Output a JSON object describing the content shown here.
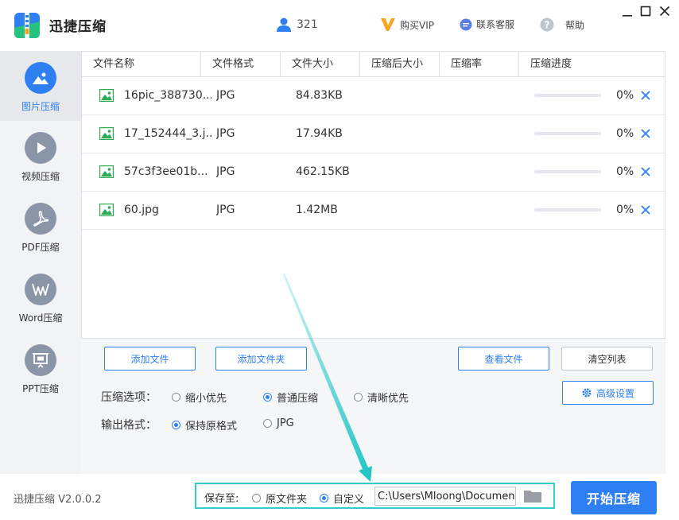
{
  "app": {
    "title": "迅捷压缩",
    "version": "迅捷压缩 V2.0.0.2"
  },
  "header": {
    "user_count": "321",
    "vip_label": "购买VIP",
    "service_label": "联系客服",
    "help_label": "帮助"
  },
  "sidebar": {
    "items": [
      {
        "label": "图片压缩",
        "icon": "image-icon",
        "active": true
      },
      {
        "label": "视频压缩",
        "icon": "play-icon",
        "active": false
      },
      {
        "label": "PDF压缩",
        "icon": "pdf-icon",
        "active": false
      },
      {
        "label": "Word压缩",
        "icon": "word-icon",
        "active": false
      },
      {
        "label": "PPT压缩",
        "icon": "ppt-icon",
        "active": false
      }
    ]
  },
  "table": {
    "columns": [
      "文件名称",
      "文件格式",
      "文件大小",
      "压缩后大小",
      "压缩率",
      "压缩进度"
    ],
    "rows": [
      {
        "name": "16pic_388730...",
        "format": "JPG",
        "size": "84.83KB",
        "compressed": "",
        "ratio": "",
        "progress": 0,
        "progress_text": "0%"
      },
      {
        "name": "17_152444_3.j...",
        "format": "JPG",
        "size": "17.94KB",
        "compressed": "",
        "ratio": "",
        "progress": 0,
        "progress_text": "0%"
      },
      {
        "name": "57c3f3ee01b...",
        "format": "JPG",
        "size": "462.15KB",
        "compressed": "",
        "ratio": "",
        "progress": 0,
        "progress_text": "0%"
      },
      {
        "name": "60.jpg",
        "format": "JPG",
        "size": "1.42MB",
        "compressed": "",
        "ratio": "",
        "progress": 0,
        "progress_text": "0%"
      }
    ]
  },
  "actions": {
    "add_file": "添加文件",
    "add_folder": "添加文件夹",
    "view_files": "查看文件",
    "clear_list": "清空列表",
    "advanced": "高级设置"
  },
  "compress_options": {
    "label": "压缩选项：",
    "options": [
      "缩小优先",
      "普通压缩",
      "清晰优先"
    ],
    "selected": "普通压缩"
  },
  "output_format": {
    "label": "输出格式：",
    "options": [
      "保持原格式",
      "JPG"
    ],
    "selected": "保持原格式"
  },
  "save": {
    "label": "保存至:",
    "options": [
      "原文件夹",
      "自定义"
    ],
    "selected": "自定义",
    "path": "C:\\Users\\Mloong\\Documents"
  },
  "start_button": "开始压缩",
  "colors": {
    "accent": "#2e7ff1",
    "highlight_box": "#33cccc",
    "sidebar_bg": "#f2f3f5"
  }
}
